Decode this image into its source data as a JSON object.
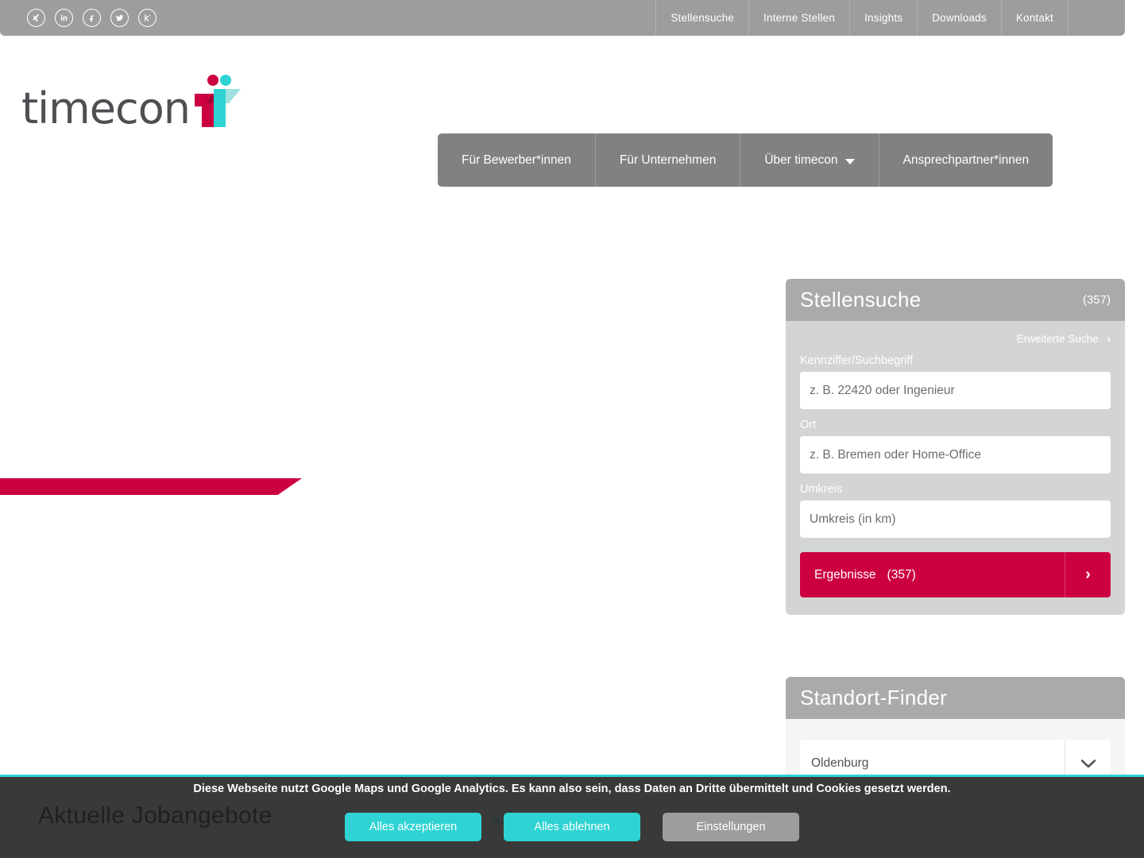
{
  "topbar": {
    "social": [
      {
        "name": "xing-icon",
        "label": "X"
      },
      {
        "name": "linkedin-icon",
        "label": "in"
      },
      {
        "name": "facebook-icon",
        "label": "f"
      },
      {
        "name": "twitter-icon",
        "label": "t"
      },
      {
        "name": "kununu-icon",
        "label": "k"
      }
    ],
    "nav": [
      {
        "label": "Stellensuche"
      },
      {
        "label": "Interne Stellen"
      },
      {
        "label": "Insights"
      },
      {
        "label": "Downloads"
      },
      {
        "label": "Kontakt"
      }
    ]
  },
  "brand": {
    "logo_text": "timecon",
    "accent_crimson": "#cc0041",
    "accent_teal": "#2fd3d3",
    "gray": "#4d4f53"
  },
  "mainnav": {
    "items": [
      {
        "label": "Für Bewerber*innen",
        "has_caret": false
      },
      {
        "label": "Für Unternehmen",
        "has_caret": false
      },
      {
        "label": "Über timecon",
        "has_caret": true
      },
      {
        "label": "Ansprechpartner*innen",
        "has_caret": false
      }
    ]
  },
  "job_search": {
    "title": "Stellensuche",
    "count": "(357)",
    "advanced_link": "Erweiterte Suche",
    "advanced_chevron": "›",
    "fields": [
      {
        "label": "Kennziffer/Suchbegriff",
        "placeholder": "z. B. 22420 oder Ingenieur",
        "value": ""
      },
      {
        "label": "Ort",
        "placeholder": "z. B. Bremen oder Home-Office",
        "value": ""
      },
      {
        "label": "Umkreis",
        "placeholder": "Umkreis (in km)",
        "value": ""
      }
    ],
    "submit_label": "Ergebnisse",
    "submit_count": "(357)",
    "submit_chevron": "›"
  },
  "location_finder": {
    "title": "Standort-Finder",
    "selected": "Oldenburg"
  },
  "bottom": {
    "heading": "Aktuelle Jobangebote",
    "sub_partial": "n Jo"
  },
  "cookie": {
    "text": "Diese Webseite nutzt Google Maps und Google Analytics. Es kann also sein, dass Daten an Dritte übermittelt und Cookies gesetzt werden.",
    "accept": "Alles akzeptieren",
    "decline": "Alles ablehnen",
    "settings": "Einstellungen"
  }
}
